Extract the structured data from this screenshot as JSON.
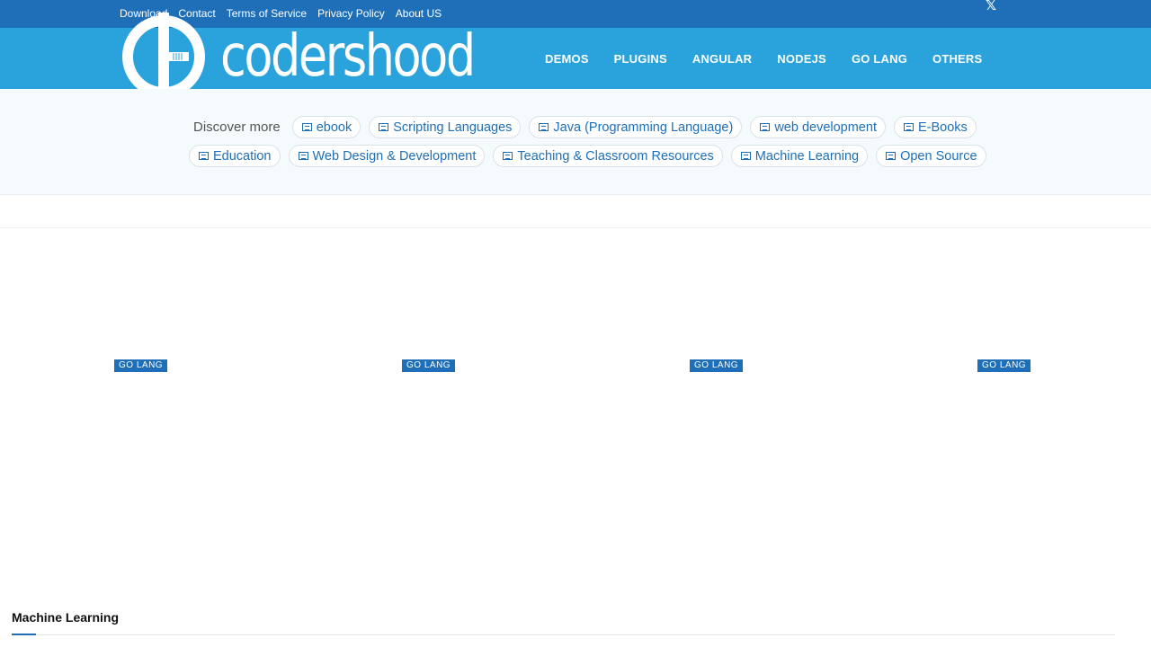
{
  "topbar": {
    "links": [
      "Download",
      "Contact",
      "Terms of Service",
      "Privacy Policy",
      "About US"
    ],
    "social_icon": "x-icon"
  },
  "header": {
    "logo_text": "codershood",
    "nav": [
      "DEMOS",
      "PLUGINS",
      "ANGULAR",
      "NODEJS",
      "GO LANG",
      "OTHERS"
    ]
  },
  "discover": {
    "label": "Discover more",
    "row1": [
      "ebook",
      "Scripting Languages",
      "Java (Programming Language)",
      "web development",
      "E-Books"
    ],
    "row2": [
      "Education",
      "Web Design & Development",
      "Teaching & Classroom Resources",
      "Machine Learning",
      "Open Source"
    ]
  },
  "posts": {
    "tags": [
      "GO LANG",
      "GO LANG",
      "GO LANG",
      "GO LANG"
    ]
  },
  "section": {
    "title": "Machine Learning"
  },
  "colors": {
    "topbar": "#1e6fb8",
    "header": "#2aa3dd",
    "accent": "#1e6fb8"
  }
}
